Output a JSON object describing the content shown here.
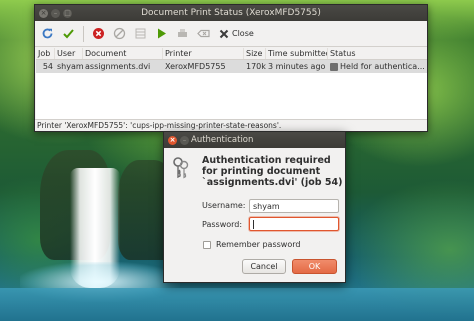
{
  "colors": {
    "accent": "#e1562e",
    "titlebar": "#3c3b37",
    "window_bg": "#f2f1f0"
  },
  "print_window": {
    "title": "Document Print Status (XeroxMFD5755)",
    "toolbar": {
      "icons": [
        "refresh-icon",
        "apply-icon",
        "cancel-job-icon",
        "stop-icon",
        "hold-icon",
        "release-icon",
        "reprint-icon",
        "clear-icon",
        "close-icon"
      ],
      "close_label": "Close"
    },
    "columns": [
      "Job",
      "User",
      "Document",
      "Printer",
      "Size",
      "Time submitted",
      "Status"
    ],
    "jobs": [
      {
        "job": "54",
        "user": "shyam",
        "document": "assignments.dvi",
        "printer": "XeroxMFD5755",
        "size": "170k",
        "time": "3 minutes ago",
        "status": "Held for authentica..."
      }
    ],
    "status_bar": "Printer 'XeroxMFD5755': 'cups-ipp-missing-printer-state-reasons'."
  },
  "auth_dialog": {
    "title": "Authentication",
    "heading": "Authentication required for printing document `assignments.dvi' (job 54)",
    "username_label": "Username:",
    "username_value": "shyam",
    "password_label": "Password:",
    "password_value": "",
    "remember_label": "Remember password",
    "remember_checked": false,
    "cancel_label": "Cancel",
    "ok_label": "OK"
  }
}
